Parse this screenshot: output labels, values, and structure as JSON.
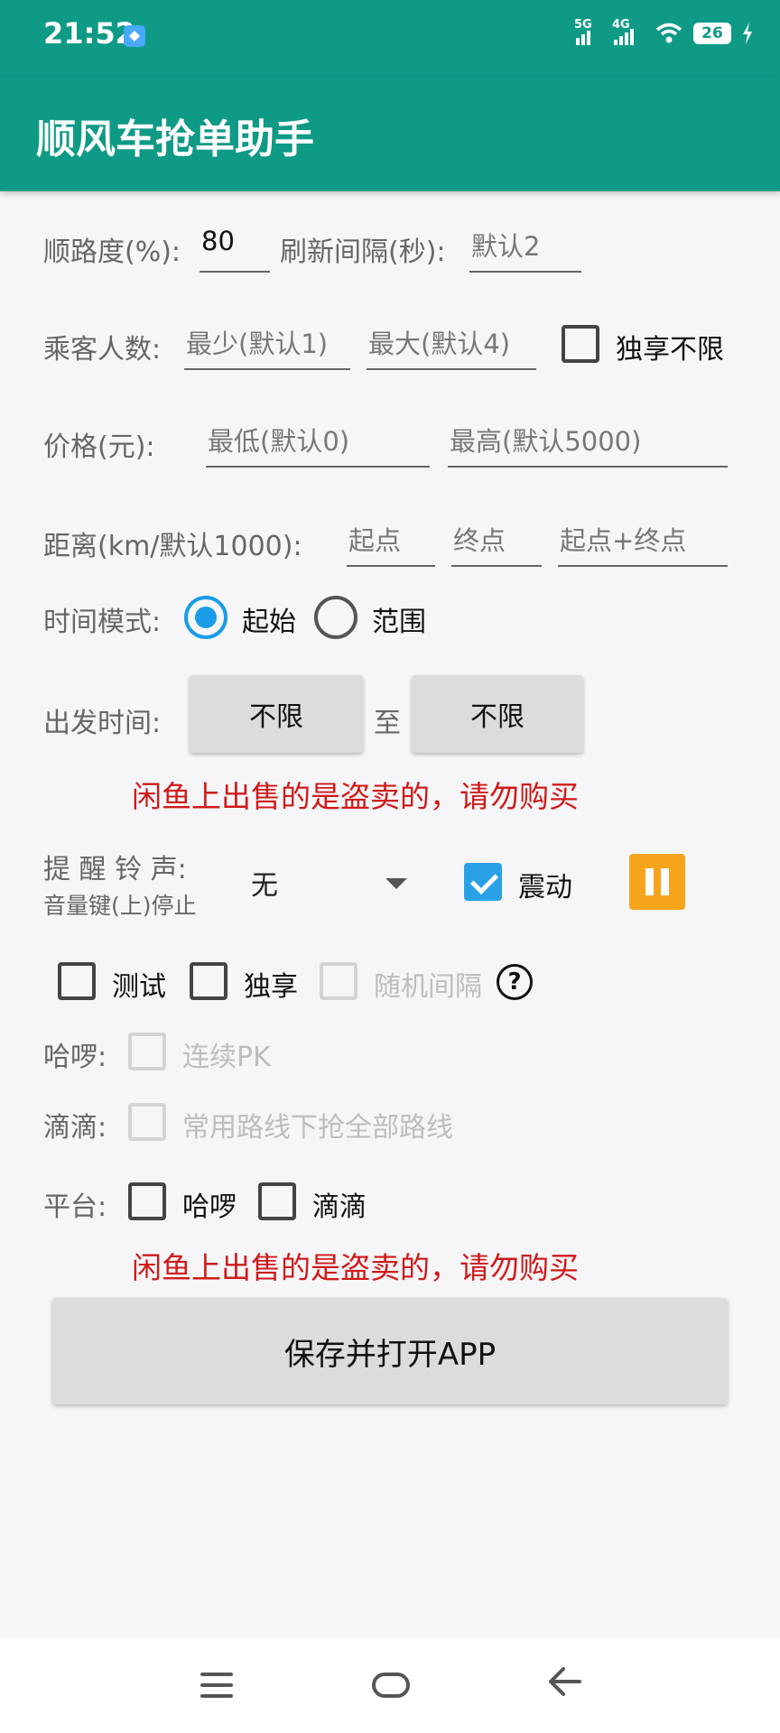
{
  "status": {
    "time": "21:52",
    "net1": "5G",
    "net2": "4G",
    "battery": "26"
  },
  "app_title": "顺风车抢单助手",
  "row_route": {
    "label": "顺路度(%):",
    "value": "80",
    "refresh_label": "刷新间隔(秒):",
    "refresh_placeholder": "默认2"
  },
  "row_passengers": {
    "label": "乘客人数:",
    "min_placeholder": "最少(默认1)",
    "max_placeholder": "最大(默认4)",
    "exclusive_label": "独享不限"
  },
  "row_price": {
    "label": "价格(元):",
    "min_placeholder": "最低(默认0)",
    "max_placeholder": "最高(默认5000)"
  },
  "row_distance": {
    "label": "距离(km/默认1000):",
    "start_placeholder": "起点",
    "end_placeholder": "终点",
    "both_placeholder": "起点+终点"
  },
  "row_time_mode": {
    "label": "时间模式:",
    "option_start": "起始",
    "option_range": "范围"
  },
  "row_depart": {
    "label": "出发时间:",
    "from_value": "不限",
    "to_text": "至",
    "to_value": "不限"
  },
  "warning": "闲鱼上出售的是盗卖的，请勿购买",
  "row_ring": {
    "label": "提 醒 铃 声:",
    "sublabel": "音量键(上)停止",
    "selected": "无",
    "vibrate_label": "震动"
  },
  "row_options": {
    "test_label": "测试",
    "exclusive_label": "独享",
    "random_label": "随机间隔",
    "help": "?"
  },
  "row_halo": {
    "label": "哈啰:",
    "option": "连续PK"
  },
  "row_didi": {
    "label": "滴滴:",
    "option": "常用路线下抢全部路线"
  },
  "row_platform": {
    "label": "平台:",
    "option_halo": "哈啰",
    "option_didi": "滴滴"
  },
  "save_button": "保存并打开APP"
}
